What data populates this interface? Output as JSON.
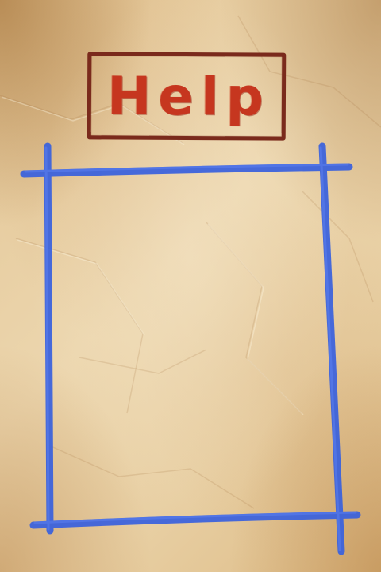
{
  "screen": {
    "title": "Help",
    "content_text": ""
  },
  "colors": {
    "title_text": "#c6361f",
    "title_border": "#7a2a1c",
    "frame_crayon": "#3d63dc",
    "paper": "#e8cfa3"
  }
}
